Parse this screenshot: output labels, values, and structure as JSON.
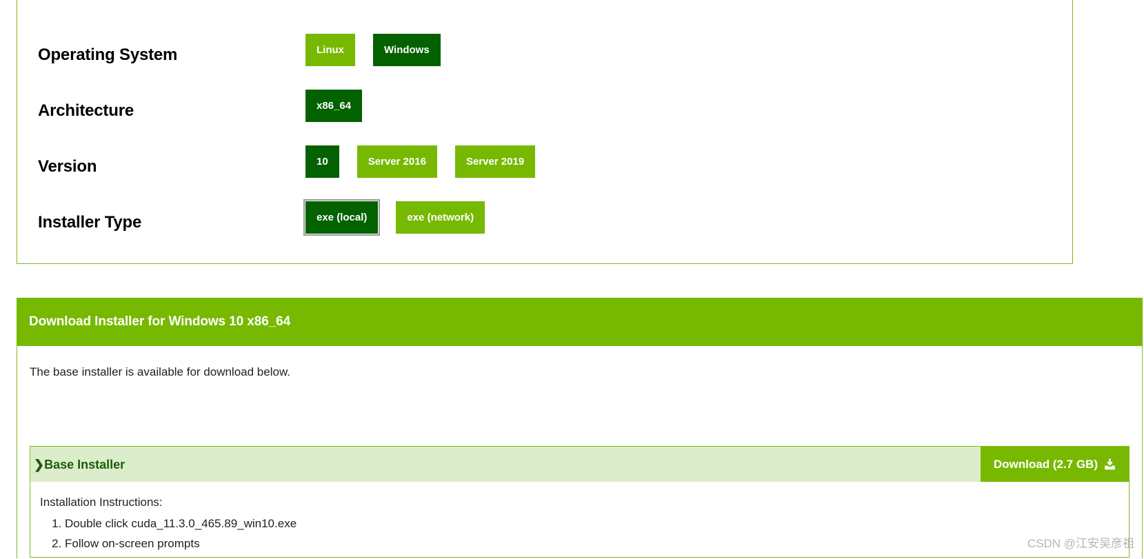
{
  "selector": {
    "rows": [
      {
        "label": "Operating System",
        "name": "operating-system",
        "options": [
          {
            "label": "Linux",
            "selected": false,
            "focused": false
          },
          {
            "label": "Windows",
            "selected": true,
            "focused": false
          }
        ]
      },
      {
        "label": "Architecture",
        "name": "architecture",
        "options": [
          {
            "label": "x86_64",
            "selected": true,
            "focused": false
          }
        ]
      },
      {
        "label": "Version",
        "name": "version",
        "options": [
          {
            "label": "10",
            "selected": true,
            "focused": false
          },
          {
            "label": "Server 2016",
            "selected": false,
            "focused": false
          },
          {
            "label": "Server 2019",
            "selected": false,
            "focused": false
          }
        ]
      },
      {
        "label": "Installer Type",
        "name": "installer-type",
        "options": [
          {
            "label": "exe (local)",
            "selected": true,
            "focused": true
          },
          {
            "label": "exe (network)",
            "selected": false,
            "focused": false
          }
        ]
      }
    ]
  },
  "download": {
    "header_title": "Download Installer for Windows 10 x86_64",
    "intro_text": "The base installer is available for download below.",
    "installer": {
      "chevron": "❯",
      "title": "Base Installer",
      "download_label": "Download (2.7 GB)",
      "download_icon": "download-icon"
    },
    "instructions_title": "Installation Instructions:",
    "instructions": [
      "Double click cuda_11.3.0_465.89_win10.exe",
      "Follow on-screen prompts"
    ]
  },
  "watermark": {
    "text": "CSDN @江安吴彦祖"
  },
  "colors": {
    "brand_green": "#76b900",
    "selected_green": "#046100",
    "pale_green": "#dcedcb",
    "border_green": "#80b81c"
  }
}
